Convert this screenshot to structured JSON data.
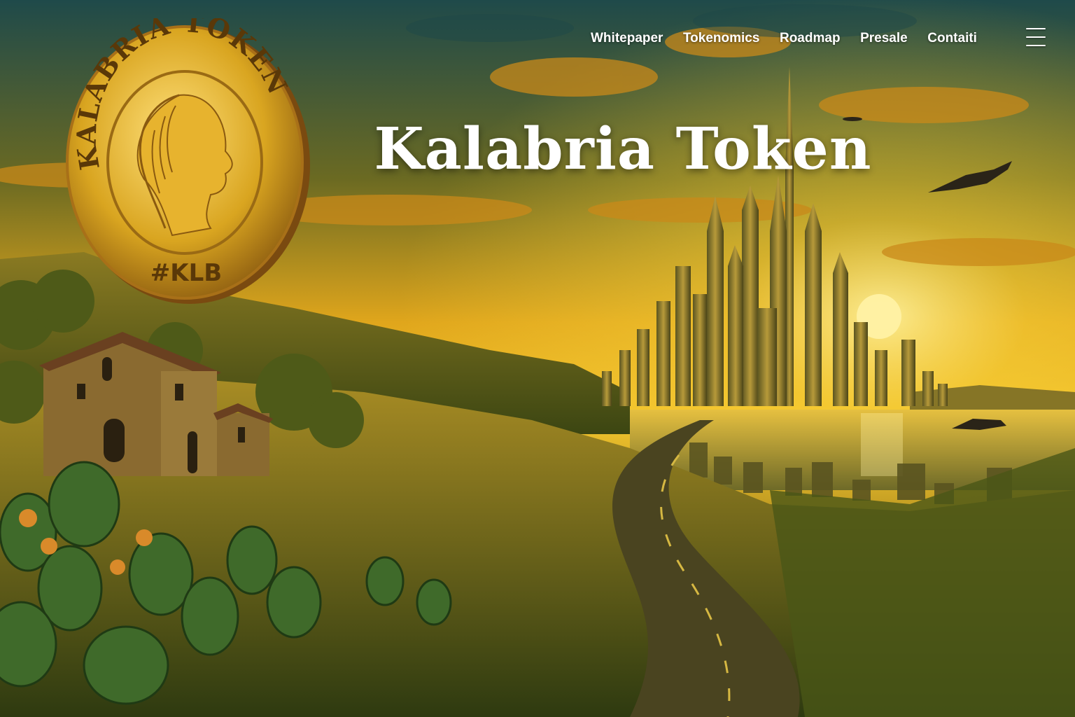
{
  "nav": {
    "links": [
      "Whitepaper",
      "Tokenomics",
      "Roadmap",
      "Presale",
      "Contaiti"
    ]
  },
  "menu": {
    "icon": "hamburger-menu-icon"
  },
  "hero": {
    "title": "Kalabria Token"
  },
  "coin": {
    "ring_text": "KALABRIA TOKEN",
    "ticker": "#KLB"
  },
  "colors": {
    "sky_top": "#1f4a4a",
    "sky_glow": "#f2c22a",
    "gold": "#d9a520",
    "grass": "#6b7a1e",
    "text": "#ffffff"
  }
}
